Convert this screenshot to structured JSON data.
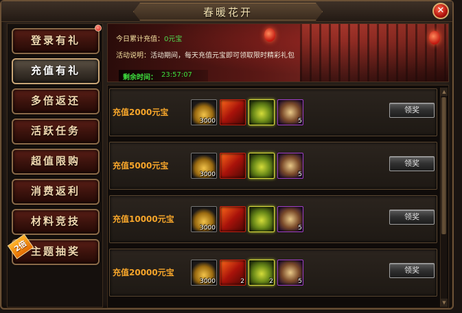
{
  "window": {
    "title": "春暖花开"
  },
  "sidebar": {
    "items": [
      {
        "label": "登录有礼"
      },
      {
        "label": "充值有礼"
      },
      {
        "label": "多倍返还"
      },
      {
        "label": "活跃任务"
      },
      {
        "label": "超值限购"
      },
      {
        "label": "消费返利"
      },
      {
        "label": "材料竞技"
      },
      {
        "label": "主题抽奖"
      }
    ],
    "badge": "2倍"
  },
  "banner": {
    "today_label": "今日累计充值：",
    "today_value": "0元宝",
    "desc_label": "活动说明：",
    "desc_text": "活动期间，每天充值元宝即可领取限时精彩礼包",
    "time_label": "剩余时间：",
    "time_value": "23:57:07"
  },
  "rewards": [
    {
      "label": "充值2000元宝",
      "items": [
        "3000",
        "",
        "",
        "5"
      ],
      "button": "领奖"
    },
    {
      "label": "充值5000元宝",
      "items": [
        "3000",
        "",
        "",
        "5"
      ],
      "button": "领奖"
    },
    {
      "label": "充值10000元宝",
      "items": [
        "3000",
        "",
        "",
        "5"
      ],
      "button": "领奖"
    },
    {
      "label": "充值20000元宝",
      "items": [
        "3000",
        "2",
        "2",
        "5"
      ],
      "button": "领奖"
    }
  ]
}
